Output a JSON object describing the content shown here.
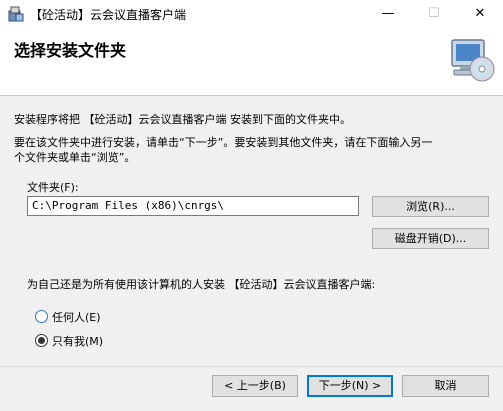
{
  "window": {
    "title": "【砼活动】云会议直播客户端",
    "minimize_glyph": "—",
    "maximize_glyph": "☐",
    "close_glyph": "✕"
  },
  "header": {
    "title": "选择安装文件夹",
    "logo_icon": "computer-cd-icon"
  },
  "body": {
    "intro": "安装程序将把 【砼活动】云会议直播客户端 安装到下面的文件夹中。",
    "instruction_line1": "要在该文件夹中进行安装，请单击“下一步”。要安装到其他文件夹，请在下面输入另一",
    "instruction_line2": "个文件夹或单击“浏览”。",
    "folder_label": "文件夹(F):",
    "folder_value": "C:\\Program Files (x86)\\cnrgs\\",
    "browse_button": "浏览(R)...",
    "disk_cost_button": "磁盘开销(D)...",
    "install_for_question": "为自己还是为所有使用该计算机的人安装 【砼活动】云会议直播客户端:",
    "options": [
      {
        "label": "任何人(E)",
        "checked": false
      },
      {
        "label": "只有我(M)",
        "checked": true
      }
    ]
  },
  "footer": {
    "back_button": "< 上一步(B)",
    "next_button": "下一步(N) >",
    "cancel_button": "取消"
  }
}
